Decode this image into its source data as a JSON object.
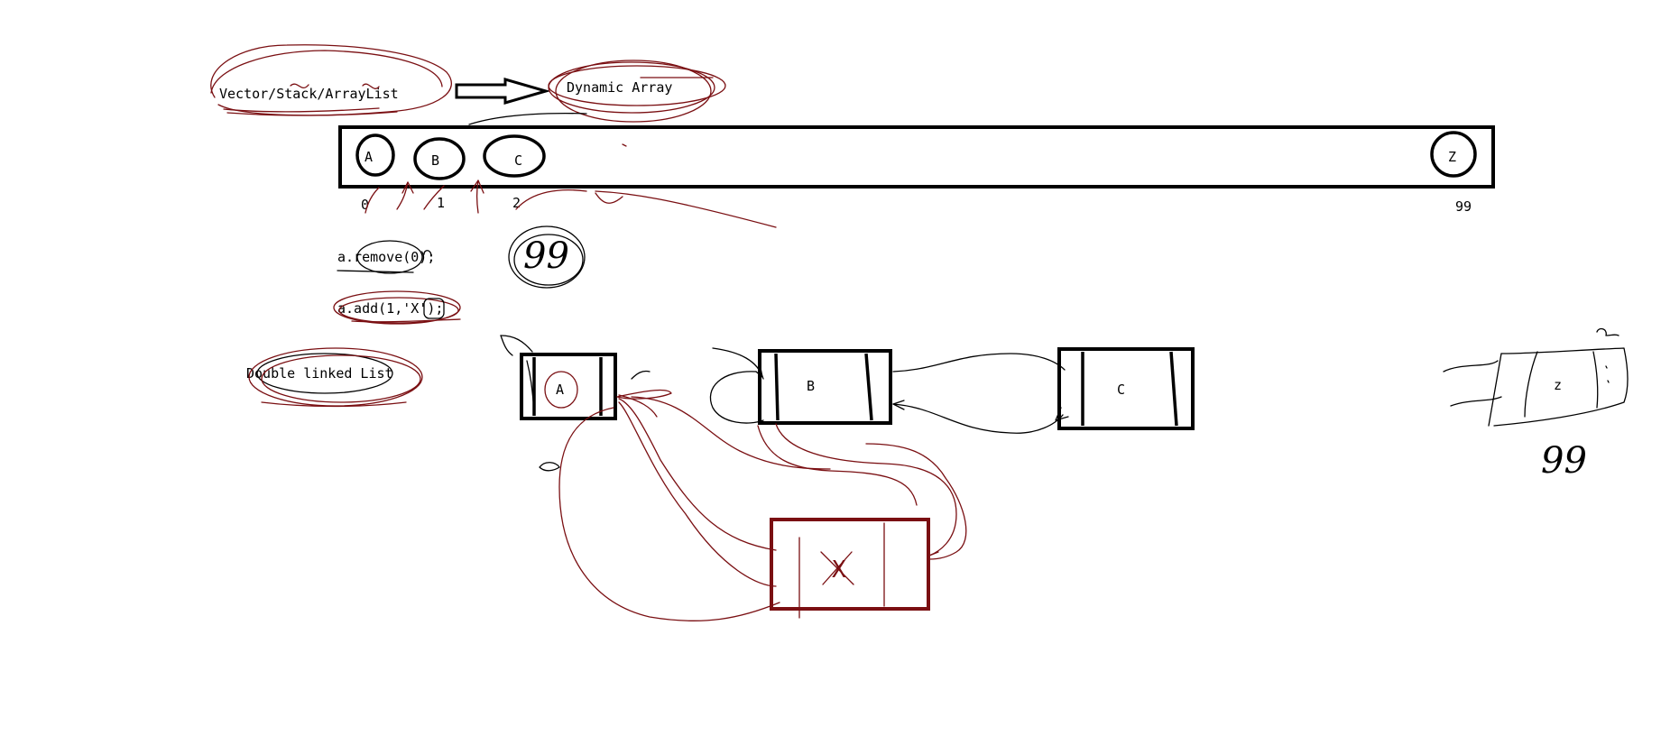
{
  "labels": {
    "top_left": "Vector/Stack/ArrayList",
    "dynamic_array": "Dynamic Array",
    "remove_call": "a.remove(0);",
    "add_call": "a.add(1,'X');",
    "linked_list": "Double linked List",
    "index_0": "0",
    "index_1": "1",
    "index_2": "2",
    "index_last": "99",
    "scribble_99": "99",
    "scribble_99_right": "99",
    "scribble_z": "z"
  },
  "array": {
    "items": [
      "A",
      "B",
      "C",
      "Z"
    ]
  },
  "linked_nodes": {
    "a": "A",
    "b": "B",
    "c": "C",
    "new": "X"
  },
  "colors": {
    "ink": "#000000",
    "annotation": "#7a0f12"
  }
}
